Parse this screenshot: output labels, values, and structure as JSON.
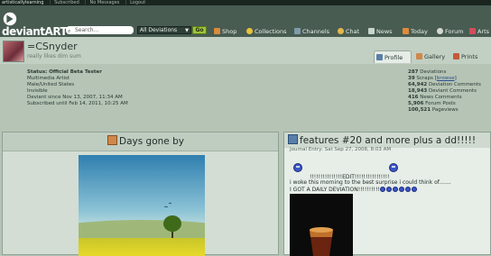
{
  "topbar": {
    "user": "artisticallylearning",
    "subscribed": "Subscribed",
    "messages": "No Messages",
    "logout": "Logout"
  },
  "header": {
    "logo_text": "deviantART",
    "search_placeholder": "Search...",
    "deviations_select": "All Deviations",
    "go_label": "Go",
    "nav": [
      {
        "label": "Shop",
        "icon": "shop-icon"
      },
      {
        "label": "Collections",
        "icon": "star-icon"
      },
      {
        "label": "Channels",
        "icon": "channels-icon"
      },
      {
        "label": "Chat",
        "icon": "chat-icon"
      },
      {
        "label": "News",
        "icon": "news-icon"
      },
      {
        "label": "Today",
        "icon": "today-icon"
      },
      {
        "label": "Forum",
        "icon": "forum-icon"
      },
      {
        "label": "Arts",
        "icon": "arts-icon"
      }
    ]
  },
  "profile": {
    "username": "=CSnyder",
    "tagline": "really likes dim sum",
    "tabs": [
      {
        "label": "Profile",
        "icon": "profile-icon",
        "active": true
      },
      {
        "label": "Gallery",
        "icon": "gallery-icon",
        "active": false
      },
      {
        "label": "Prints",
        "icon": "prints-icon",
        "active": false
      }
    ],
    "info": {
      "status": "Status: Official Beta Tester",
      "line1": "Multimedia Artist",
      "line2": "Male/United States",
      "line3": "Invisible",
      "line4": "Deviant since Nov 13, 2007, 11:34 AM",
      "line5": "Subscribed until Feb 14, 2011, 10:25 AM"
    },
    "stats": [
      {
        "value": "287",
        "label": "Deviations"
      },
      {
        "value": "39",
        "label": "Scraps",
        "link": "browse"
      },
      {
        "value": "64,942",
        "label": "Deviation Comments"
      },
      {
        "value": "18,943",
        "label": "Deviant Comments"
      },
      {
        "value": "416",
        "label": "News Comments"
      },
      {
        "value": "5,906",
        "label": "Forum Posts"
      },
      {
        "value": "100,521",
        "label": "Pageviews"
      }
    ]
  },
  "left_panel": {
    "title": "Days gone by",
    "icon": "deviation-icon"
  },
  "right_panel": {
    "title": "features #20 and more plus a dd!!!!!",
    "icon": "journal-icon",
    "entry": "Journal Entry: Sat Sep 27, 2008, 8:03 AM",
    "line1": "!!!!!!!!!!!!!!!EDIT!!!!!!!!!!!!!!!!",
    "line2": "i woke this morning to the best surprise i could think of.......",
    "line3": "I GOT A DAILY DEVIATION!!!!!!!!!!"
  },
  "colors": {
    "header_bg": "#485c52",
    "page_bg": "#b5c4b5",
    "go_button": "#9dc33d"
  }
}
